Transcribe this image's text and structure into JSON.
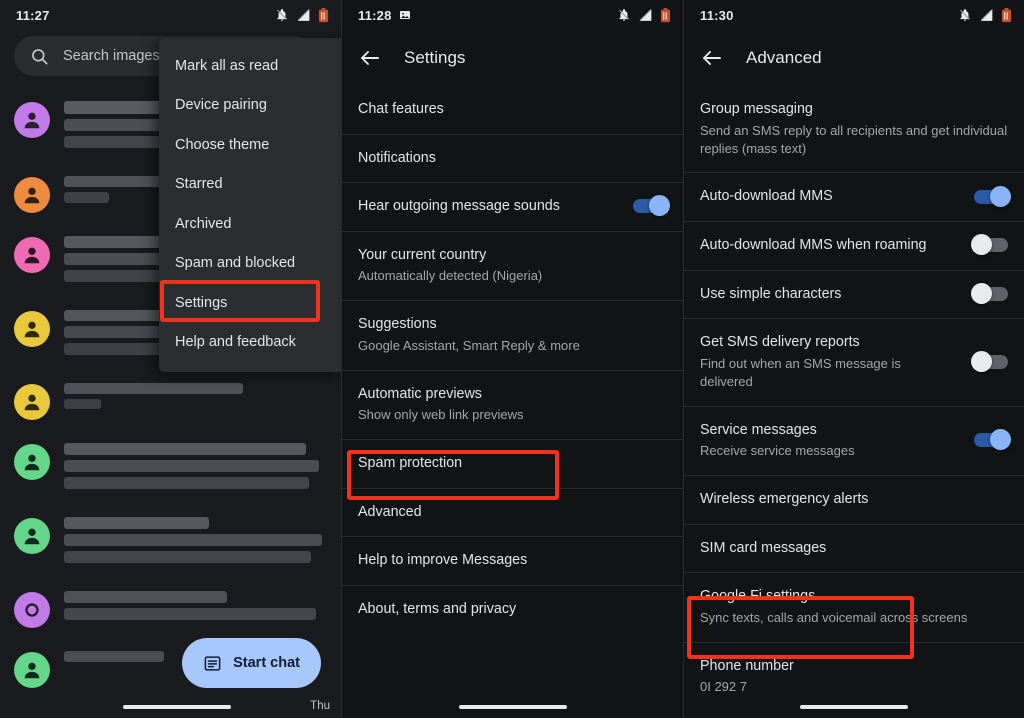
{
  "screens": [
    {
      "id": "conversations",
      "status_bar": {
        "time": "11:27",
        "icons": [
          "notifications-off-icon",
          "signal-error-icon",
          "battery-low-icon"
        ]
      },
      "search": {
        "value": "",
        "placeholder": "Search images an"
      },
      "start_chat_label": "Start chat",
      "day_label": "Thu",
      "conversations": [
        {
          "avatar_color": "#c27ae8",
          "avatar_icon": "person-icon"
        },
        {
          "avatar_color": "#ef8a41",
          "avatar_icon": "person-icon"
        },
        {
          "avatar_color": "#f06ab4",
          "avatar_icon": "person-icon"
        },
        {
          "avatar_color": "#e8c93c",
          "avatar_icon": "person-icon"
        },
        {
          "avatar_color": "#e8c93c",
          "avatar_icon": "person-icon"
        },
        {
          "avatar_color": "#63d68a",
          "avatar_icon": "person-icon"
        },
        {
          "avatar_color": "#63d68a",
          "avatar_icon": "person-icon"
        },
        {
          "avatar_color": "#c27ae8",
          "avatar_icon": "circle-icon"
        },
        {
          "avatar_color": "#63d68a",
          "avatar_icon": "person-icon"
        }
      ],
      "overflow_menu": {
        "items": [
          {
            "label": "Mark all as read"
          },
          {
            "label": "Device pairing"
          },
          {
            "label": "Choose theme"
          },
          {
            "label": "Starred"
          },
          {
            "label": "Archived"
          },
          {
            "label": "Spam and blocked"
          },
          {
            "label": "Settings"
          },
          {
            "label": "Help and feedback"
          }
        ],
        "highlighted_item": "Settings"
      }
    },
    {
      "id": "settings",
      "status_bar": {
        "time": "11:28",
        "icons": [
          "image-icon",
          "notifications-off-icon",
          "signal-error-icon",
          "battery-low-icon"
        ]
      },
      "app_bar": {
        "back_label": "back-arrow",
        "title": "Settings"
      },
      "rows": [
        {
          "title": "Chat features"
        },
        {
          "title": "Notifications"
        },
        {
          "title": "Hear outgoing message sounds",
          "toggle": "on"
        },
        {
          "title": "Your current country",
          "subtitle": "Automatically detected (Nigeria)"
        },
        {
          "title": "Suggestions",
          "subtitle": "Google Assistant, Smart Reply & more"
        },
        {
          "title": "Automatic previews",
          "subtitle": "Show only web link previews"
        },
        {
          "title": "Spam protection"
        },
        {
          "title": "Advanced"
        },
        {
          "title": "Help to improve Messages"
        },
        {
          "title": "About, terms and privacy"
        }
      ],
      "highlighted_row": "Advanced"
    },
    {
      "id": "advanced",
      "status_bar": {
        "time": "11:30",
        "icons": [
          "notifications-off-icon",
          "signal-error-icon",
          "battery-low-icon"
        ]
      },
      "app_bar": {
        "back_label": "back-arrow",
        "title": "Advanced"
      },
      "rows": [
        {
          "title": "Group messaging",
          "subtitle": "Send an SMS reply to all recipients and get individual replies (mass text)"
        },
        {
          "title": "Auto-download MMS",
          "toggle": "on"
        },
        {
          "title": "Auto-download MMS when roaming",
          "toggle": "off"
        },
        {
          "title": "Use simple characters",
          "toggle": "off"
        },
        {
          "title": "Get SMS delivery reports",
          "subtitle": "Find out when an SMS message is delivered",
          "toggle": "off"
        },
        {
          "title": "Service messages",
          "subtitle": "Receive service messages",
          "toggle": "on"
        },
        {
          "title": "Wireless emergency alerts"
        },
        {
          "title": "SIM card messages"
        },
        {
          "title": "Google Fi settings",
          "subtitle": "Sync texts, calls and voicemail across screens"
        },
        {
          "title": "Phone number",
          "subtitle": "0I    292 7"
        }
      ],
      "highlighted_row": "Phone number"
    }
  ],
  "colors": {
    "highlight": "#f4321a",
    "accent_blue": "#8ab4f8",
    "fab": "#a8c7fa",
    "background": "#121315",
    "menu_background": "#2b2d31"
  }
}
